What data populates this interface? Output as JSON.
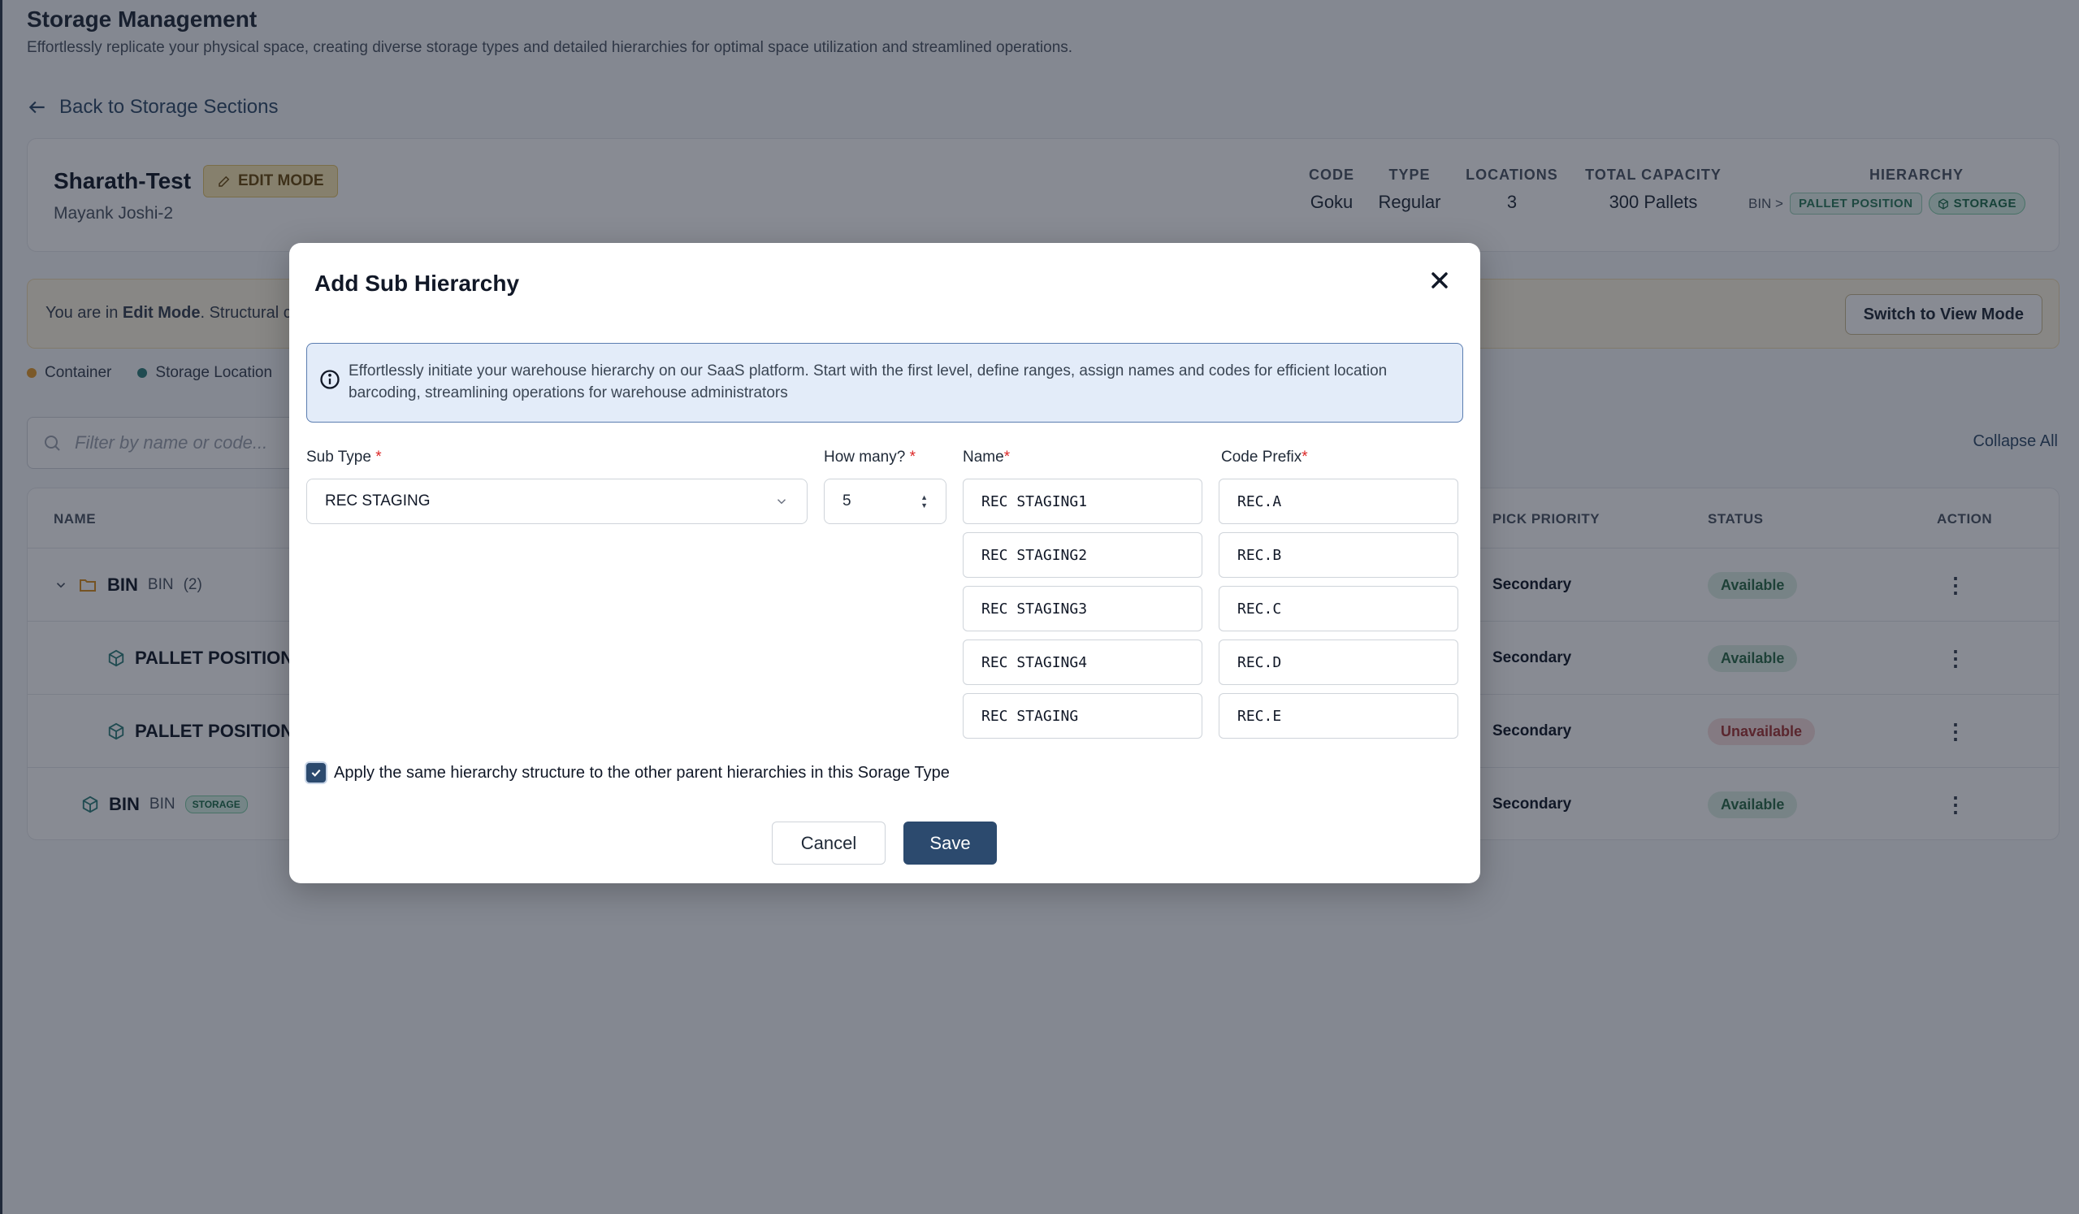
{
  "page": {
    "title": "Storage Management",
    "subtitle": "Effortlessly replicate your physical space, creating diverse storage types and detailed hierarchies for optimal space utilization and streamlined operations.",
    "back_label": "Back to Storage Sections"
  },
  "section": {
    "name": "Sharath-Test",
    "mode_badge": "EDIT MODE",
    "owner": "Mayank Joshi-2",
    "stats": [
      {
        "label": "CODE",
        "value": "Goku"
      },
      {
        "label": "TYPE",
        "value": "Regular"
      },
      {
        "label": "LOCATIONS",
        "value": "3"
      },
      {
        "label": "TOTAL CAPACITY",
        "value": "300 Pallets"
      }
    ],
    "hierarchy": {
      "label": "HIERARCHY",
      "root": "BIN >",
      "level1": "PALLET POSITION",
      "level2": "STORAGE"
    }
  },
  "banner": {
    "prefix": "You are in ",
    "mode": "Edit Mode",
    "suffix": ". Structural ch",
    "switch_label": "Switch to View Mode"
  },
  "legend": [
    {
      "label": "Container",
      "color": "#e59b2b"
    },
    {
      "label": "Storage Location",
      "color": "#2f7f7a"
    }
  ],
  "filter": {
    "placeholder": "Filter by name or code..."
  },
  "collapse_label": "Collapse All",
  "table": {
    "headers": {
      "name": "NAME",
      "priority": "PICK PRIORITY",
      "status": "STATUS",
      "action": "ACTION"
    },
    "rows": [
      {
        "name": "BIN",
        "code": "BIN",
        "count": "(2)",
        "priority": "Secondary",
        "status": "Available"
      },
      {
        "name": "PALLET POSITION",
        "priority": "Secondary",
        "status": "Available"
      },
      {
        "name": "PALLET POSITION",
        "priority": "Secondary",
        "status": "Unavailable"
      },
      {
        "name": "BIN",
        "code": "BIN",
        "tag": "STORAGE",
        "priority": "Secondary",
        "status": "Available"
      }
    ]
  },
  "modal": {
    "title": "Add Sub Hierarchy",
    "info": "Effortlessly initiate your warehouse hierarchy on our SaaS platform. Start with the first level, define ranges, assign names and codes for efficient location barcoding, streamlining operations for warehouse administrators",
    "sub_type_label": "Sub Type",
    "sub_type_value": "REC STAGING",
    "how_many_label": "How many?",
    "how_many_value": "5",
    "name_label": "Name",
    "code_label": "Code Prefix",
    "required_mark": "*",
    "names": [
      "REC STAGING1",
      "REC STAGING2",
      "REC STAGING3",
      "REC STAGING4",
      "REC STAGING"
    ],
    "codes": [
      "REC.A",
      "REC.B",
      "REC.C",
      "REC.D",
      "REC.E"
    ],
    "apply_label": "Apply the same hierarchy structure to the other parent hierarchies in this Sorage Type",
    "apply_checked": true,
    "cancel_label": "Cancel",
    "save_label": "Save"
  }
}
